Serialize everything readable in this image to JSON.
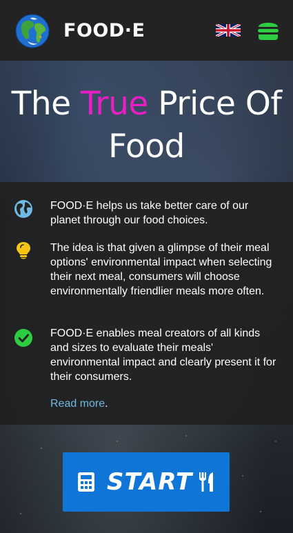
{
  "header": {
    "brand": "FOOD·E",
    "language_icon": "uk-flag-icon",
    "menu_icon": "burger-menu-icon",
    "colors": {
      "background": "#232323",
      "menu_icon": "#2ecc40"
    }
  },
  "hero": {
    "title_before": "The ",
    "title_accent": "True",
    "title_after": " Price Of Food",
    "accent_color": "#e91ec4"
  },
  "info": {
    "items": [
      {
        "icon": "globe-icon",
        "icon_color": "#6fb9e4",
        "text": "FOOD·E helps us take better care of our planet through our food choices."
      },
      {
        "icon": "lightbulb-icon",
        "icon_color": "#f4c514",
        "text": "The idea is that given a glimpse of their meal options' environmental impact when selecting their next meal, consumers will choose environmentally friendlier meals more often."
      },
      {
        "icon": "check-circle-icon",
        "icon_color": "#2ecc40",
        "text": "FOOD·E enables meal creators of all kinds and sizes to evaluate their meals' environmental impact and clearly present it for their consumers."
      }
    ],
    "read_more_label": "Read more",
    "read_more_suffix": ".",
    "link_color": "#6fb9e4"
  },
  "start_button": {
    "label": "START",
    "left_icon": "calculator-icon",
    "right_icon": "utensils-icon",
    "color": "#0f76d7"
  }
}
